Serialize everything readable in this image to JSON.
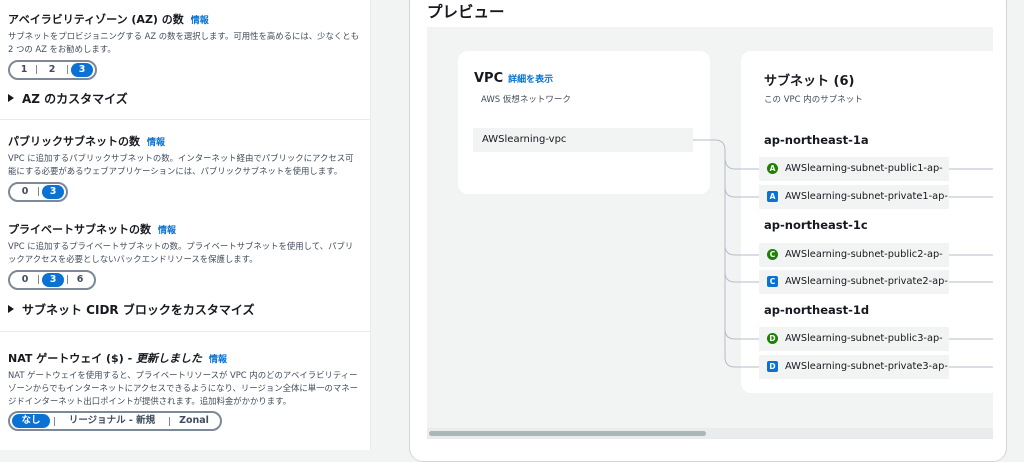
{
  "az": {
    "title": "アベイラビリティゾーン (AZ) の数",
    "info": "情報",
    "desc": "サブネットをプロビジョニングする AZ の数を選択します。可用性を高めるには、少なくとも 2 つの AZ をお勧めします。",
    "options": [
      "1",
      "2",
      "3"
    ],
    "selected": "3",
    "customize": "AZ のカスタマイズ"
  },
  "public": {
    "title": "パブリックサブネットの数",
    "info": "情報",
    "desc": "VPC に追加するパブリックサブネットの数。インターネット経由でパブリックにアクセス可能にする必要があるウェブアプリケーションには、パブリックサブネットを使用します。",
    "options": [
      "0",
      "3"
    ],
    "selected": "3"
  },
  "private": {
    "title": "プライベートサブネットの数",
    "info": "情報",
    "desc": "VPC に追加するプライベートサブネットの数。プライベートサブネットを使用して、パブリックアクセスを必要としないバックエンドリソースを保護します。",
    "options": [
      "0",
      "3",
      "6"
    ],
    "selected": "3",
    "customize": "サブネット CIDR ブロックをカスタマイズ"
  },
  "nat": {
    "title_plain": "NAT ゲートウェイ ($) - ",
    "title_italic": "更新しました",
    "info": "情報",
    "desc": "NAT ゲートウェイを使用すると、プライベートリソースが VPC 内のどのアベイラビリティーゾーンからでもインターネットにアクセスできるようになり、リージョン全体に単一のマネージドインターネット出口ポイントが提供されます。追加料金がかかります。",
    "options": [
      "なし",
      "リージョナル - 新規",
      "Zonal"
    ],
    "selected": "なし"
  },
  "preview": {
    "title": "プレビュー",
    "vpc": {
      "title": "VPC",
      "link": "詳細を表示",
      "subtitle": "AWS 仮想ネットワーク",
      "name": "AWSlearning-vpc"
    },
    "subnets": {
      "title": "サブネット (6)",
      "subtitle": "この VPC 内のサブネット",
      "groups": [
        {
          "az": "ap-northeast-1a",
          "items": [
            {
              "icon": "A",
              "kind": "public",
              "name": "AWSlearning-subnet-public1-ap-"
            },
            {
              "icon": "A",
              "kind": "private",
              "name": "AWSlearning-subnet-private1-ap-"
            }
          ]
        },
        {
          "az": "ap-northeast-1c",
          "items": [
            {
              "icon": "C",
              "kind": "public",
              "name": "AWSlearning-subnet-public2-ap-"
            },
            {
              "icon": "C",
              "kind": "private",
              "name": "AWSlearning-subnet-private2-ap-"
            }
          ]
        },
        {
          "az": "ap-northeast-1d",
          "items": [
            {
              "icon": "D",
              "kind": "public",
              "name": "AWSlearning-subnet-public3-ap-"
            },
            {
              "icon": "D",
              "kind": "private",
              "name": "AWSlearning-subnet-private3-ap-"
            }
          ]
        }
      ]
    }
  },
  "colors": {
    "accent": "#0972d3",
    "public_icon": "#1d8102",
    "private_icon": "#0972d3"
  }
}
